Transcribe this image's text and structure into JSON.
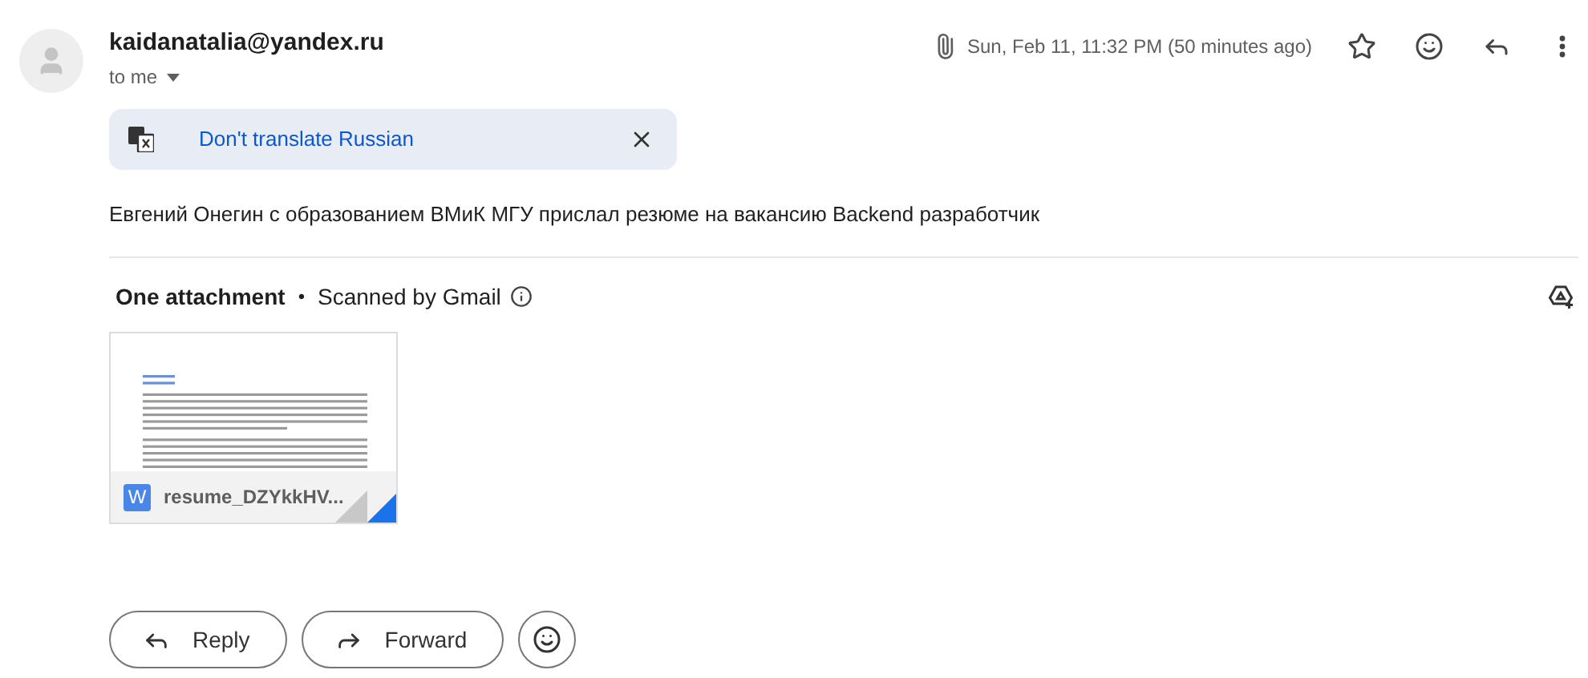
{
  "sender": {
    "email": "kaidanatalia@yandex.ru",
    "recipient": "to me"
  },
  "header": {
    "date": "Sun, Feb 11, 11:32 PM (50 minutes ago)"
  },
  "translate_bar": {
    "link": "Don't translate Russian"
  },
  "body": "Евгений Онегин с образованием ВМиК МГУ прислал резюме на вакансию Backend разработчик",
  "attachments": {
    "title": "One attachment",
    "separator": "•",
    "scan_note": "Scanned by Gmail",
    "files": [
      {
        "type_letter": "W",
        "name": "resume_DZYkkHV..."
      }
    ]
  },
  "actions": [
    {
      "kind": "reply",
      "label": "Reply"
    },
    {
      "kind": "forward",
      "label": "Forward"
    },
    {
      "kind": "emoji"
    }
  ]
}
